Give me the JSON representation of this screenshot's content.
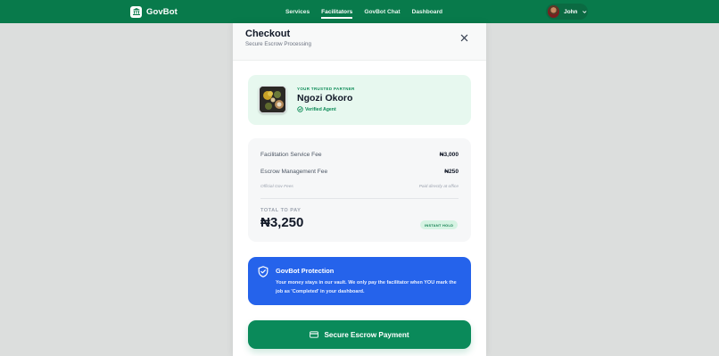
{
  "app": {
    "brand": "GovBot",
    "nav": [
      {
        "label": "Services",
        "active": false
      },
      {
        "label": "Facilitators",
        "active": true
      },
      {
        "label": "GovBot Chat",
        "active": false
      },
      {
        "label": "Dashboard",
        "active": false
      }
    ],
    "user": {
      "name": "John"
    }
  },
  "checkout": {
    "title": "Checkout",
    "subtitle": "Secure Escrow Processing",
    "partner": {
      "tag": "YOUR TRUSTED PARTNER",
      "name": "Ngozi Okoro",
      "verified_label": "Verified Agent"
    },
    "fees": {
      "service_label": "Facilitation Service Fee",
      "service_amount": "₦3,000",
      "escrow_label": "Escrow Management Fee",
      "escrow_amount": "₦250",
      "note_left": "Official Gov Fees",
      "note_right": "Paid directly at office",
      "total_label": "TOTAL TO PAY",
      "total_amount": "₦3,250",
      "badge": "INSTANT HOLD"
    },
    "protection": {
      "title": "GovBot Protection",
      "text": "Your money stays in our vault. We only pay the facilitator when YOU mark the job as 'Completed' in your dashboard."
    },
    "pay_button": "Secure Escrow Payment"
  },
  "colors": {
    "nav_green": "#087a4b",
    "accent_green": "#0a8a5a",
    "protection_blue": "#2563eb",
    "partner_bg": "#e7f8ef"
  },
  "icons": [
    "building-icon",
    "chevron-down-icon",
    "close-icon",
    "verified-check-icon",
    "shield-check-icon",
    "credit-card-icon"
  ]
}
